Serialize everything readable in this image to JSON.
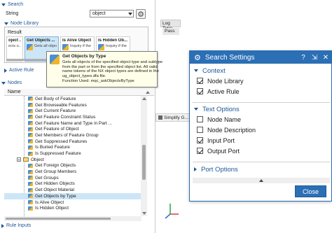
{
  "search": {
    "header": "Search",
    "string_label": "String",
    "string_value": "object",
    "node_library_label": "Node Library",
    "result_label": "Result",
    "cards": [
      {
        "title": "oject ...",
        "desc": "ects o..."
      },
      {
        "title": "Get Objects ...",
        "desc": "Gets all objects of..."
      },
      {
        "title": "Is Alive Object",
        "desc": "Inquiry if the ..."
      },
      {
        "title": "Is Hidden Ob...",
        "desc": "Inquiry if the ..."
      }
    ],
    "active_rule_label": "Active Rule"
  },
  "nodes": {
    "header": "Nodes",
    "column_name": "Name",
    "rows": [
      {
        "label": "Get Body of Feature",
        "kind": "item"
      },
      {
        "label": "Get Browseable Features",
        "kind": "item"
      },
      {
        "label": "Get Current Feature",
        "kind": "item"
      },
      {
        "label": "Get Feature Constraint Status",
        "kind": "item"
      },
      {
        "label": "Get Feature Name and Type in Part ...",
        "kind": "item"
      },
      {
        "label": "Get Feature of Object",
        "kind": "item"
      },
      {
        "label": "Get Members of Feature Group",
        "kind": "item"
      },
      {
        "label": "Get Suppressed Features",
        "kind": "item"
      },
      {
        "label": "Is Buried Feature",
        "kind": "item"
      },
      {
        "label": "Is Suppressed Feature",
        "kind": "item"
      },
      {
        "label": "Object",
        "kind": "folder"
      },
      {
        "label": "Get Foreign Objects",
        "kind": "item"
      },
      {
        "label": "Get Group Members",
        "kind": "item"
      },
      {
        "label": "Get Groups",
        "kind": "item"
      },
      {
        "label": "Get Hidden Objects",
        "kind": "item"
      },
      {
        "label": "Get Object Material",
        "kind": "item"
      },
      {
        "label": "Get Objects by Type",
        "kind": "item",
        "selected": true
      },
      {
        "label": "Is Alive Object",
        "kind": "item"
      },
      {
        "label": "Is Hidden Object",
        "kind": "item"
      }
    ]
  },
  "rule_inputs_label": "Rule Inputs",
  "graphics": {
    "log_tab": "Log Type",
    "pass_cell": "Pass",
    "simplify_tab": "Simplify G..."
  },
  "tooltip": {
    "title": "Get Objects by Type",
    "lines": [
      "Gets all objects of the specified object type and subtype",
      "from the part  or from the specified object list.  All valid",
      "name tokens of the NX object types are defined in the",
      "ug_object_types.dfa file.",
      "Function Used: mqc_askObjectsByType"
    ]
  },
  "dialog": {
    "title": "Search Settings",
    "help": "?",
    "close_x": "✕",
    "sections": {
      "context": {
        "label": "Context",
        "items": [
          {
            "label": "Node Library",
            "checked": true
          },
          {
            "label": "Active Rule",
            "checked": true
          }
        ]
      },
      "text_options": {
        "label": "Text Options",
        "items": [
          {
            "label": "Node Name",
            "checked": false
          },
          {
            "label": "Node Description",
            "checked": false
          },
          {
            "label": "Input Port",
            "checked": true
          },
          {
            "label": "Output Port",
            "checked": true
          }
        ]
      },
      "port_options": {
        "label": "Port Options"
      }
    },
    "close_button": "Close"
  },
  "colors": {
    "accent": "#2b6fb5",
    "section_text": "#1e5799",
    "selection": "#cde6f7",
    "tooltip_bg": "#ffffe9"
  }
}
